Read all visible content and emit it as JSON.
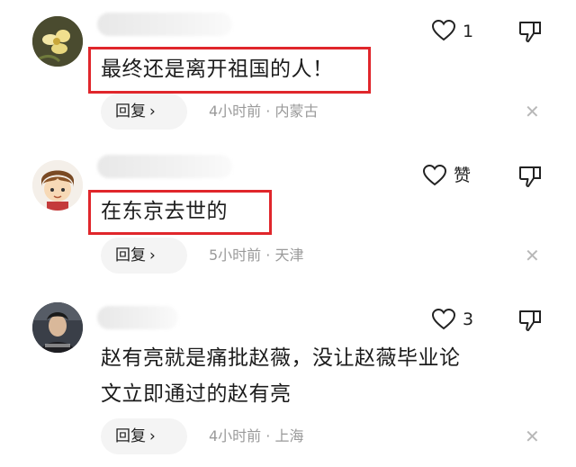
{
  "comments": [
    {
      "text": "最终还是离开祖国的人！",
      "likes": "1",
      "reply_label": "回复",
      "time": "4小时前",
      "location": "内蒙古",
      "highlighted": true
    },
    {
      "text": "在东京去世的",
      "likes": "赞",
      "reply_label": "回复",
      "time": "5小时前",
      "location": "天津",
      "highlighted": true
    },
    {
      "text_lines": [
        "赵有亮就是痛批赵薇，没让赵薇毕业论",
        "文立即通过的赵有亮"
      ],
      "likes": "3",
      "reply_label": "回复",
      "time": "4小时前",
      "location": "上海",
      "highlighted": false
    }
  ],
  "meta_separator": "·",
  "icons": {
    "like": "heart-outline-icon",
    "dislike": "thumb-down-icon",
    "close": "close-icon",
    "chevron": "chevron-right-icon"
  },
  "colors": {
    "highlight_border": "#e0262b",
    "meta_text": "#9a9a9a",
    "reply_bg": "#f4f4f4"
  }
}
